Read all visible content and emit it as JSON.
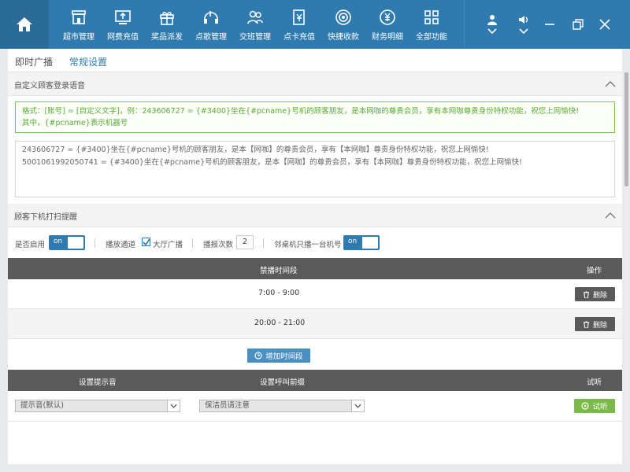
{
  "nav": {
    "items": [
      {
        "label": "超市管理",
        "icon": "store-icon"
      },
      {
        "label": "网费充值",
        "icon": "monitor-recharge-icon"
      },
      {
        "label": "奖品派发",
        "icon": "gift-icon"
      },
      {
        "label": "点歌管理",
        "icon": "music-icon"
      },
      {
        "label": "交班管理",
        "icon": "users-icon"
      },
      {
        "label": "点卡充值",
        "icon": "card-icon"
      },
      {
        "label": "快捷收款",
        "icon": "coin-icon"
      },
      {
        "label": "财务明细",
        "icon": "finance-icon"
      },
      {
        "label": "全部功能",
        "icon": "grid-icon"
      }
    ]
  },
  "tabs": {
    "instant": "即时广播",
    "regular": "常规设置"
  },
  "login_voice": {
    "title": "自定义顾客登录语音",
    "hint_line1": "格式：[账号] = [自定义文字]，例：243606727 = {#3400}坐在{#pcname}号机的顾客朋友，是本网咖的尊贵会员，享有本网咖尊贵身份特权功能，祝您上网愉快!",
    "hint_line2": "其中，{#pcname}表示机器号",
    "content_line1": "243606727 = {#3400}坐在{#pcname}号机的顾客朋友，是本【网咖】的尊贵会员，享有【本网咖】尊贵身份特权功能，祝您上网愉快!",
    "content_line2": "5001061992050741 = {#3400}坐在{#pcname}号机的顾客朋友，是本【网咖】的尊贵会员，享有【本网咖】尊贵身份特权功能，祝您上网愉快!"
  },
  "offline_reminder": {
    "title": "顾客下机打扫提醒",
    "enabled_label": "是否启用",
    "enabled_toggle": "on",
    "channel_label": "播放通道",
    "channel_option": "大厅广播",
    "count_label": "播报次数",
    "count_value": "2",
    "adjacent_label": "邻桌机只播一台机号",
    "adjacent_toggle": "on"
  },
  "forbidden_table": {
    "col_period": "禁播时间段",
    "col_action": "操作",
    "rows": [
      {
        "time": "7:00  -  9:00",
        "delete": "删除"
      },
      {
        "time": "20:00  -  21:00",
        "delete": "删除"
      }
    ],
    "add_button": "增加时间段"
  },
  "sound_table": {
    "col_tone": "设置提示音",
    "col_prefix": "设置呼叫前缀",
    "col_listen": "试听",
    "tone_value": "提示音(默认)",
    "prefix_value": "保洁员请注意",
    "listen_button": "试听"
  },
  "colors": {
    "primary": "#2f7aae",
    "header_dark": "#5a5a5a",
    "success": "#7ab94a",
    "hint_green": "#5aaa33"
  }
}
